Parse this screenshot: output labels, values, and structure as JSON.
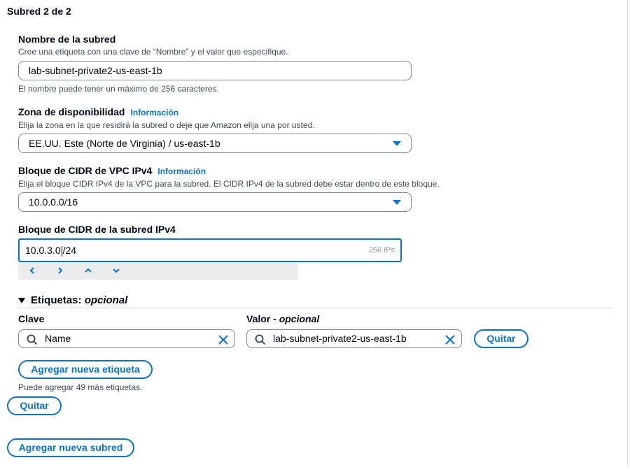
{
  "section": {
    "title": "Subred 2 de 2"
  },
  "name": {
    "label": "Nombre de la subred",
    "description": "Cree una etiqueta con una clave de “Nombre” y el valor que especifique.",
    "value": "lab-subnet-private2-us-east-1b",
    "hint": "El nombre puede tener un máximo de 256 caracteres."
  },
  "az": {
    "label": "Zona de disponibilidad",
    "info": "Información",
    "description": "Elija la zona en la que residirá la subred o deje que Amazon elija una por usted.",
    "value": "EE.UU. Este (Norte de Virginia) / us-east-1b"
  },
  "vpc_cidr": {
    "label": "Bloque de CIDR de VPC IPv4",
    "info": "Información",
    "description": "Elija el bloque CIDR IPv4 de la VPC para la subred. El CIDR IPv4 de la subred debe estar dentro de este bloque.",
    "value": "10.0.0.0/16"
  },
  "subnet_cidr": {
    "label": "Bloque de CIDR de la subred IPv4",
    "value_before_cursor": "10.0.3.0",
    "value_after_cursor": "/24",
    "ip_count": "256 IPs"
  },
  "tags": {
    "heading": "Etiquetas:",
    "heading_optional": "opcional",
    "key_label": "Clave",
    "value_label": "Valor -",
    "value_label_optional": "opcional",
    "key_value": "Name",
    "value_value": "lab-subnet-private2-us-east-1b",
    "remove_button": "Quitar",
    "add_button": "Agregar nueva etiqueta",
    "hint": "Puede agregar 49 más etiquetas."
  },
  "subnet_actions": {
    "remove_button": "Quitar",
    "add_subnet_button": "Agregar nueva subred"
  },
  "colors": {
    "accent": "#0972d3",
    "border": "#7d8998",
    "text": "#000716",
    "muted": "#414d5c"
  },
  "icons": [
    "chevron-left-icon",
    "chevron-right-icon",
    "chevron-up-icon",
    "chevron-down-icon",
    "search-icon",
    "clear-icon",
    "caret-down-icon"
  ]
}
